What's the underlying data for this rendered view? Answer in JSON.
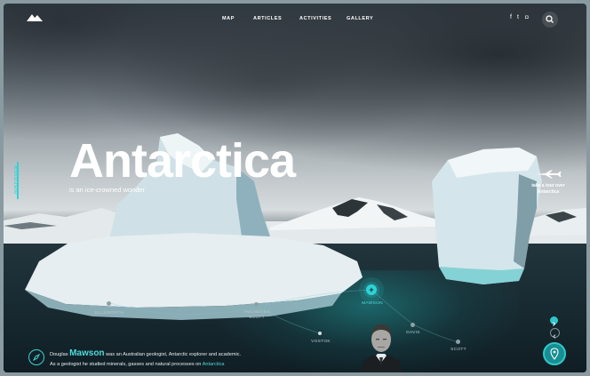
{
  "nav": {
    "links": [
      "MAP",
      "ARTICLES",
      "ACTIVITIES",
      "GALLERY"
    ],
    "social_icons": [
      "facebook-icon",
      "twitter-icon",
      "instagram-icon"
    ],
    "social_glyphs": [
      "f",
      "t",
      "◘"
    ]
  },
  "side_label": "DISCOVER",
  "hero": {
    "title": "Antarctica",
    "subtitle": "is an ice-crowned wonder"
  },
  "tour": {
    "line1": "take a tour over",
    "line2": "Antarctica"
  },
  "stations": [
    {
      "name": "ELLSWORTH",
      "active": false
    },
    {
      "name": "AMUNDSEN\nSCOTT",
      "active": false
    },
    {
      "name": "MAWSON",
      "active": true
    },
    {
      "name": "VOSTOK",
      "active": false
    },
    {
      "name": "DAVIS",
      "active": false
    },
    {
      "name": "SCOTT",
      "active": false
    }
  ],
  "bio": {
    "first_name": "Douglas",
    "last_name": "Mawson",
    "line1_rest": "was an Australian geologist, Antarctic explorer and academic.",
    "line2": "As a geologist he studied minerals, gasses and natural processes on",
    "line2_link": "Antarctica"
  },
  "colors": {
    "accent": "#2fd3d6",
    "ice": "#e8f1f4"
  }
}
